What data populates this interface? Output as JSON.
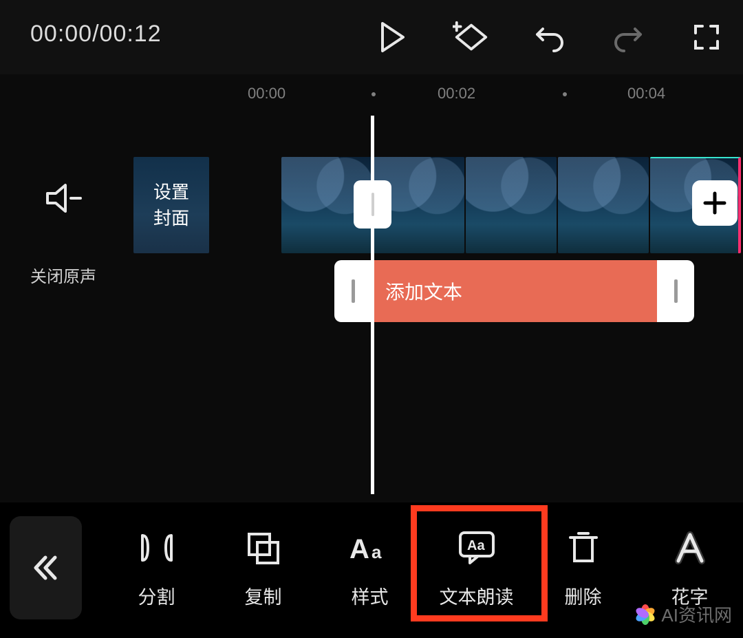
{
  "top": {
    "timecode": "00:00/00:12"
  },
  "ruler": {
    "t0": "00:00",
    "t1": "00:02",
    "t2": "00:04"
  },
  "timeline": {
    "mute_label": "关闭原声",
    "cover_label": "设置\n封面",
    "text_clip_label": "添加文本"
  },
  "tools": {
    "split": "分割",
    "copy": "复制",
    "style": "样式",
    "tts": "文本朗读",
    "delete": "删除",
    "artfont": "花字"
  },
  "watermark": {
    "text": "AI资讯网"
  }
}
